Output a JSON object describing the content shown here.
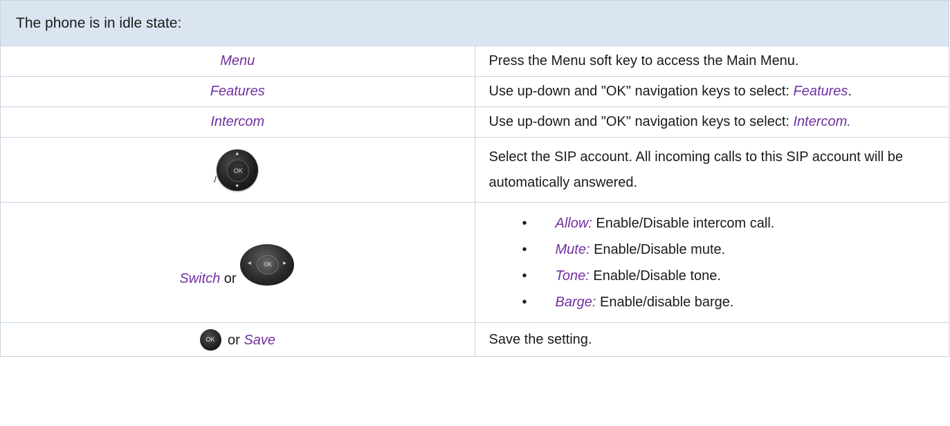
{
  "header": {
    "text": "The phone is in idle state:"
  },
  "rows": [
    {
      "left": "Menu",
      "right": "Press the Menu soft key to access the Main Menu."
    },
    {
      "left": "Features",
      "right_prefix": "Use up-down and \"OK\" navigation keys to select: ",
      "right_highlight": "Features",
      "right_suffix": "."
    },
    {
      "left": "Intercom",
      "right_prefix": "Use up-down and \"OK\" navigation keys to select: ",
      "right_highlight": "Intercom."
    },
    {
      "left_icon": "up-down-navigation-key-icon",
      "left_icon_text": "OK",
      "left_separator": "/",
      "right": "Select the SIP account. All incoming calls to this SIP account will be automatically answered."
    },
    {
      "left_label": "Switch",
      "left_or": " or",
      "left_icon": "left-right-navigation-key-icon",
      "left_icon_text": "OK",
      "options": [
        {
          "label": "Allow:",
          "text": " Enable/Disable intercom call."
        },
        {
          "label": "Mute:",
          "text": " Enable/Disable mute."
        },
        {
          "label": "Tone:",
          "text": " Enable/Disable tone."
        },
        {
          "label": "Barge:",
          "text": " Enable/disable barge."
        }
      ],
      "bullet": "•"
    },
    {
      "left_icon": "ok-key-icon",
      "left_icon_text": "OK",
      "left_or": " or ",
      "left_label": "Save",
      "right": "Save the setting."
    }
  ],
  "colors": {
    "header_bg": "#dbe5f1",
    "highlight": "#7030a0",
    "border": "#c8d3df"
  }
}
